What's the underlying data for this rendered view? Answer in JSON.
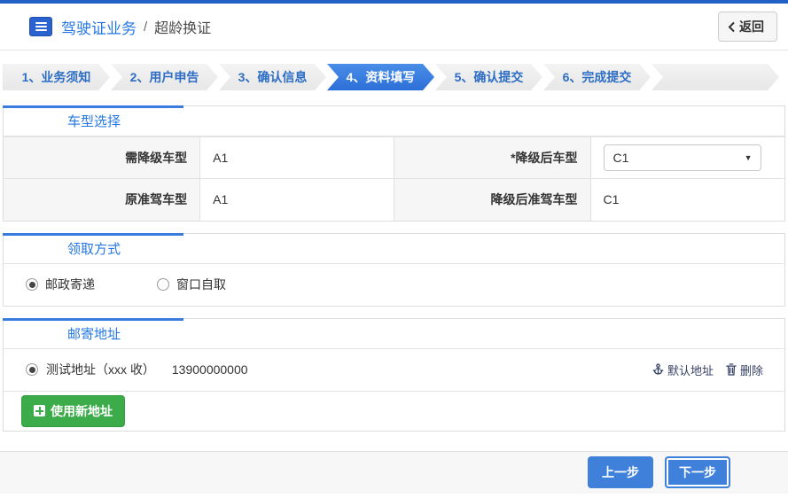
{
  "header": {
    "title_primary": "驾驶证业务",
    "title_separator": "/",
    "title_secondary": "超龄换证",
    "back_label": "返回"
  },
  "steps": [
    {
      "label": "1、业务须知",
      "active": false
    },
    {
      "label": "2、用户申告",
      "active": false
    },
    {
      "label": "3、确认信息",
      "active": false
    },
    {
      "label": "4、资料填写",
      "active": true
    },
    {
      "label": "5、确认提交",
      "active": false
    },
    {
      "label": "6、完成提交",
      "active": false
    }
  ],
  "vehicle_section": {
    "title": "车型选择",
    "rows": [
      {
        "label1": "需降级车型",
        "value1": "A1",
        "label2": "*降级后车型",
        "value2": "C1"
      },
      {
        "label1": "原准驾车型",
        "value1": "A1",
        "label2": "降级后准驾车型",
        "value2": "C1"
      }
    ],
    "select": {
      "selected_value": "C1"
    }
  },
  "pickup_section": {
    "title": "领取方式",
    "options": [
      {
        "label": "邮政寄递",
        "selected": true
      },
      {
        "label": "窗口自取",
        "selected": false
      }
    ]
  },
  "address_section": {
    "title": "邮寄地址",
    "address": {
      "text": "测试地址（xxx 收）",
      "phone": "13900000000",
      "selected": true
    },
    "default_link": "默认地址",
    "delete_link": "删除",
    "new_address_button": "使用新地址"
  },
  "footer": {
    "prev_label": "上一步",
    "next_label": "下一步"
  },
  "colors": {
    "accent_blue": "#2160c4",
    "link_blue": "#2577e3",
    "active_step_blue": "#2b6fd8",
    "button_blue": "#3f81da",
    "green": "#3cab49",
    "label_bg": "#f6f6f6"
  }
}
